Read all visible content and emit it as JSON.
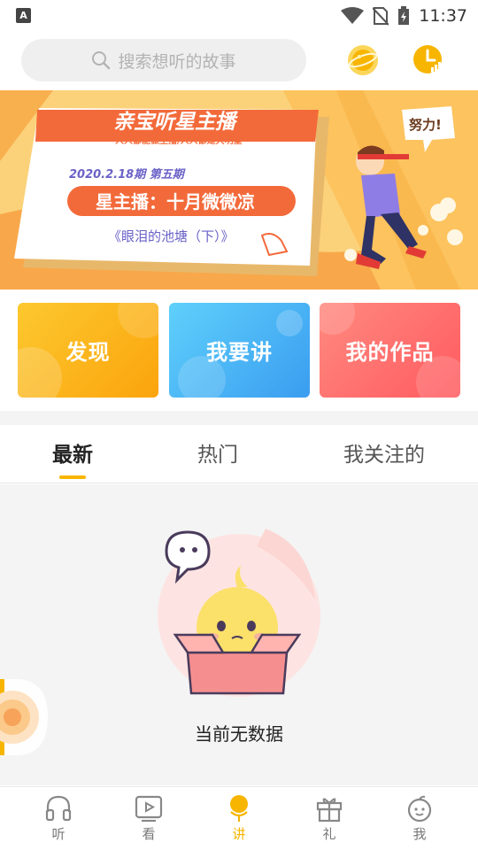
{
  "status_bar": {
    "time": "11:37",
    "left_icon": "A"
  },
  "search": {
    "placeholder": "搜索想听的故事"
  },
  "top_icons": {
    "left": "planet-icon",
    "right": "clock-stats-icon"
  },
  "banner": {
    "title": "亲宝听星主播",
    "subtitle": "人人都能做主播/人人都是大明星",
    "issue": "2020.2.18期 第五期",
    "host_line": "星主播：十月微微凉",
    "story": "《眼泪的池塘（下）》",
    "bubble": "努力!"
  },
  "cards": [
    {
      "label": "发现",
      "color": "#fdb814"
    },
    {
      "label": "我要讲",
      "color": "#4fb7f5"
    },
    {
      "label": "我的作品",
      "color": "#ff6c6c"
    }
  ],
  "tabs": [
    {
      "label": "最新",
      "active": true
    },
    {
      "label": "热门",
      "active": false
    },
    {
      "label": "我关注的",
      "active": false
    }
  ],
  "empty_state": {
    "message": "当前无数据"
  },
  "bottom_nav": [
    {
      "label": "听",
      "icon": "headphones-icon",
      "active": false
    },
    {
      "label": "看",
      "icon": "play-screen-icon",
      "active": false
    },
    {
      "label": "讲",
      "icon": "microphone-icon",
      "active": true
    },
    {
      "label": "礼",
      "icon": "gift-icon",
      "active": false
    },
    {
      "label": "我",
      "icon": "profile-face-icon",
      "active": false
    }
  ],
  "colors": {
    "accent": "#f7b500",
    "banner_bg": "#f9c25a",
    "banner_ribbon": "#f36a3a"
  }
}
